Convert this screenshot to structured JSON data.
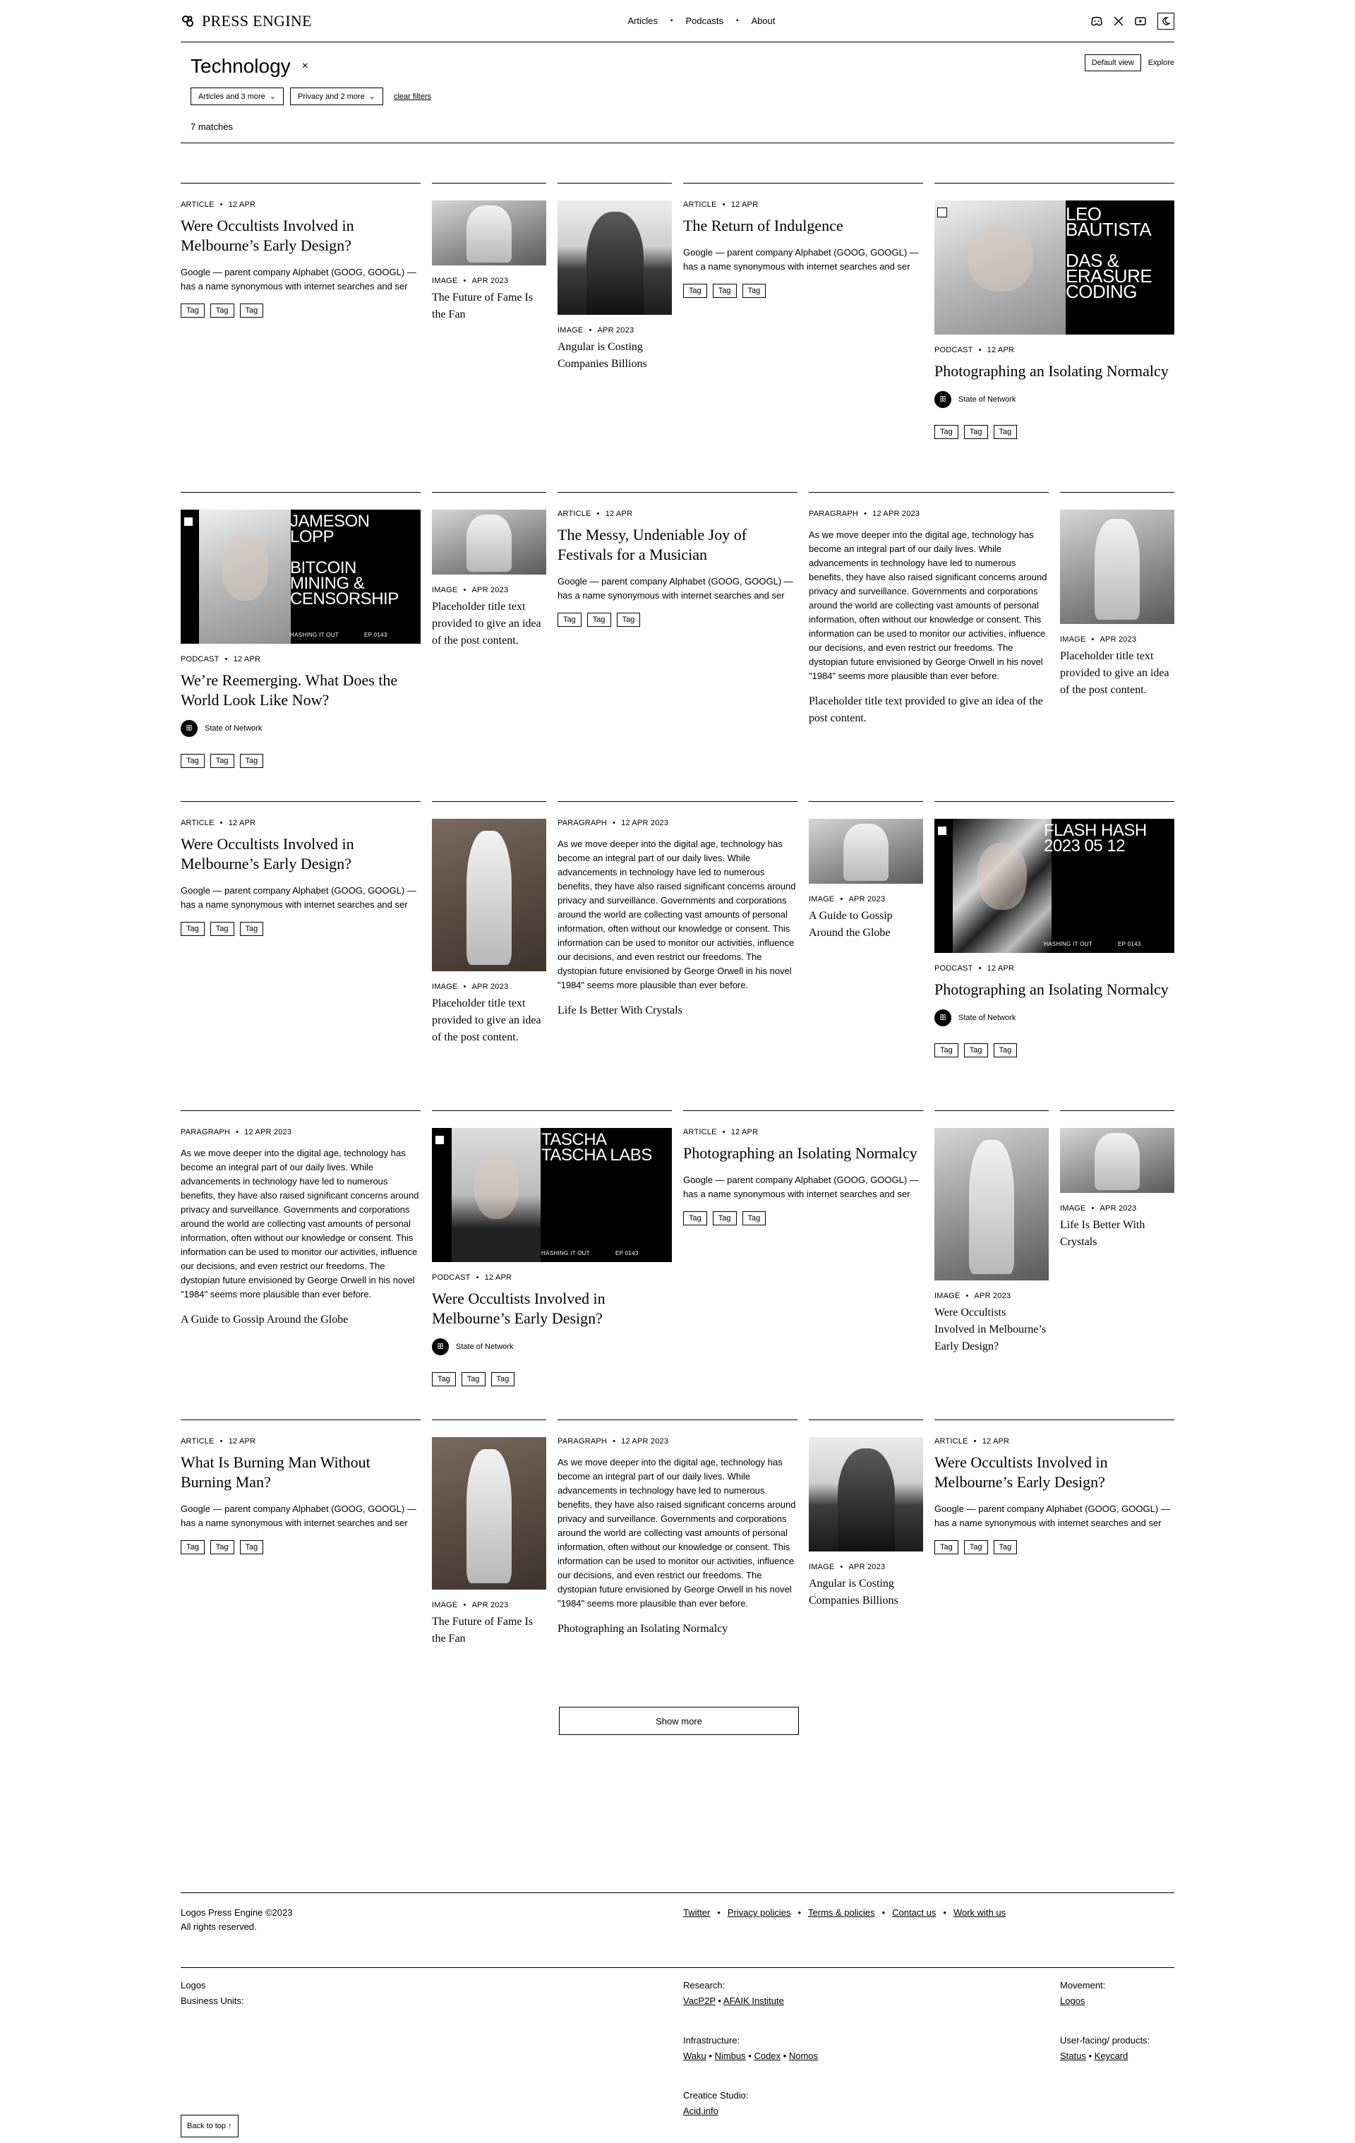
{
  "header": {
    "brand": "PRESS ENGINE",
    "nav": [
      "Articles",
      "Podcasts",
      "About"
    ],
    "icons": [
      "discord-icon",
      "x-icon",
      "youtube-icon",
      "moon-icon"
    ]
  },
  "filter": {
    "title": "Technology",
    "close": "×",
    "default_view": "Default view",
    "explore": "Explore",
    "dropdown1": "Articles and 3 more",
    "dropdown2": "Privacy and 2 more",
    "clear": "clear filters",
    "matches": "7 matches"
  },
  "common": {
    "article": "ARTICLE",
    "image": "IMAGE",
    "podcast": "PODCAST",
    "paragraph": "PARAGRAPH",
    "date_short": "12 APR",
    "date_month": "APR 2023",
    "date_full": "12 APR 2023",
    "excerpt": "Google — parent company Alphabet (GOOG, GOOGL) —has a name synonymous with internet searches and ser",
    "tag": "Tag",
    "author": "State of Network",
    "paragraph_text": "As we move deeper into the digital age, technology has become an integral part of our daily lives. While advancements in technology have led to numerous benefits, they have also raised significant concerns around privacy and surveillance. Governments and corporations around the world are collecting vast amounts of personal information, often without our knowledge or consent. This information can be used to monitor our activities, influence our decisions, and even restrict our freedoms. The dystopian future envisioned by George Orwell in his novel \"1984\" seems more plausible than ever before.",
    "placeholder": "Placeholder title text provided to give an idea of the post content.",
    "hashing": "HASHING IT OUT"
  },
  "titles": {
    "occultists": "Were Occultists Involved in Melbourne’s Early Design?",
    "fame": "The Future of Fame Is the Fan",
    "costing": "Angular is Costing Companies Billions",
    "indulgence": "The Return of Indulgence",
    "isolating": "Photographing an Isolating Normalcy",
    "reemerging": "We’re Reemerging. What Does the World Look Like Now?",
    "messy": "The Messy, Undeniable Joy of Festivals for a Musician",
    "gossip": "A Guide to Gossip Around the Globe",
    "crystals": "Life Is Better With Crystals",
    "burning": "What Is Burning Man Without Burning Man?"
  },
  "podcasts": {
    "leo": {
      "text": "LEO BAUTISTA\n\nDAS & ERASURE CODING"
    },
    "jameson": {
      "text": "JAMESON LOPP\n\nBITCOIN MINING & CENSORSHIP",
      "ep": "EP 0143"
    },
    "flash": {
      "text": "FLASH HASH 2023 05 12",
      "ep": "EP 0143"
    },
    "tascha": {
      "text": "TASCHA TASCHA LABS",
      "ep": "EP 0143"
    }
  },
  "show_more": "Show more",
  "footer": {
    "copyright": "Logos Press Engine ©2023",
    "rights": "All rights reserved.",
    "links": [
      "Twitter",
      "Privacy policies",
      "Terms & policies",
      "Contact us",
      "Work with us"
    ],
    "logos": "Logos",
    "business_units": "Business Units:",
    "research_label": "Research:",
    "research": [
      "VacP2P",
      "AFAIK Institute"
    ],
    "infra_label": "Infrastructure:",
    "infra": [
      "Waku",
      "Nimbus",
      "Codex",
      "Nomos"
    ],
    "studio_label": "Creatice Studio:",
    "studio": [
      "Acid.info"
    ],
    "movement_label": "Movement:",
    "movement": [
      "Logos"
    ],
    "user_label": "User-facing/ products:",
    "user": [
      "Status",
      "Keycard"
    ],
    "back_to_top": "Back to top ↑"
  }
}
